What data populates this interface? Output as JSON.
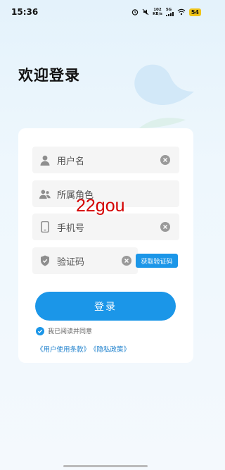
{
  "status_bar": {
    "time": "15:36",
    "net_speed_value": "102",
    "net_speed_unit": "KB/s",
    "signal_label": "5G",
    "battery": "54"
  },
  "page": {
    "title": "欢迎登录"
  },
  "form": {
    "username": {
      "placeholder": "用户名"
    },
    "role": {
      "placeholder": "所属角色"
    },
    "phone": {
      "placeholder": "手机号"
    },
    "code": {
      "placeholder": "验证码"
    },
    "get_code_label": "获取验证码",
    "login_label": "登录",
    "agree_text": "我已阅读并同意",
    "user_terms": "《用户使用条款》",
    "privacy_policy": "《隐私政策》"
  },
  "watermark": "22gou",
  "colors": {
    "accent": "#1b96e8",
    "watermark": "#d40000"
  },
  "icons": {
    "username": "user-icon",
    "role": "user-group-icon",
    "phone": "phone-icon",
    "code": "shield-check-icon",
    "clear": "clear-icon",
    "checkbox": "check-icon"
  }
}
